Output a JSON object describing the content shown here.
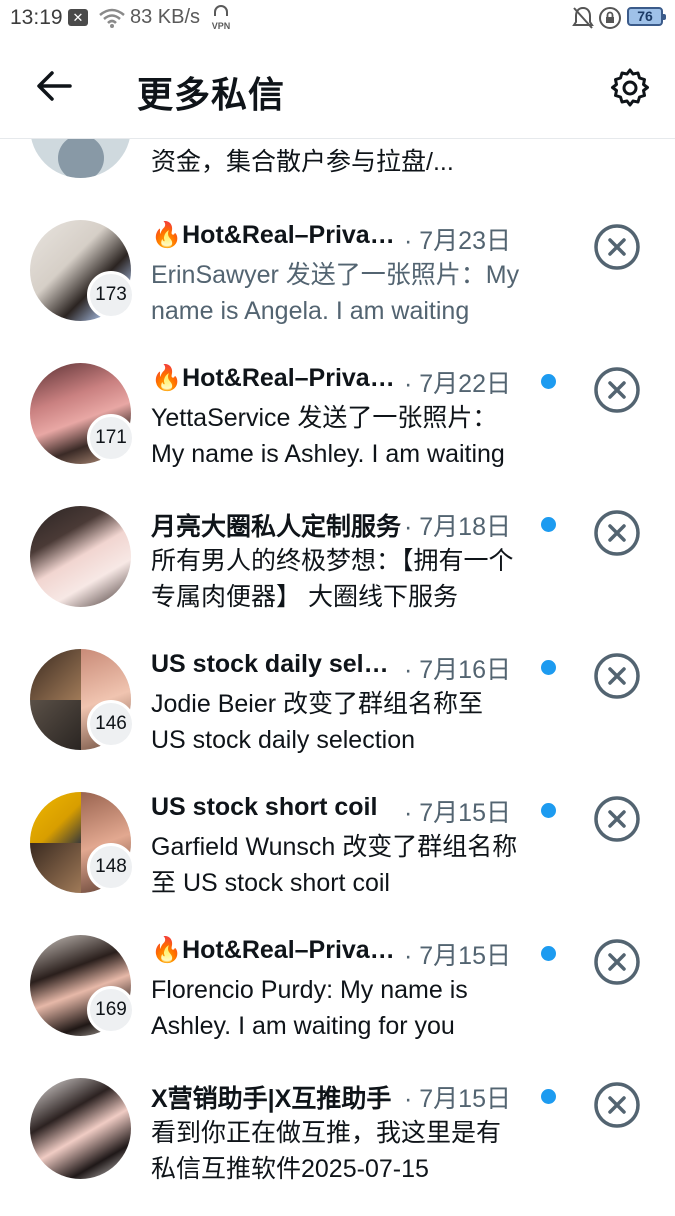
{
  "status_bar": {
    "time": "13:19",
    "notif_icon": "x-notification-icon",
    "network_speed": "83 KB/s",
    "vpn": "VPN",
    "battery": "76"
  },
  "header": {
    "title": "更多私信",
    "back_icon": "back-arrow-icon",
    "settings_icon": "gear-icon"
  },
  "partial_row": {
    "preview": "资金，集合散户参与拉盘/..."
  },
  "conversations": [
    {
      "name": "🔥Hot&Real–Private Chat",
      "date": "· 7月23日",
      "preview": "ErinSawyer 发送了一张照片：My name is Angela. I am waiting",
      "badge": "173",
      "unread": false
    },
    {
      "name": "🔥Hot&Real–Private Chat",
      "date": "· 7月22日",
      "preview": "YettaService 发送了一张照片：My name is Ashley. I am waiting",
      "badge": "171",
      "unread": true
    },
    {
      "name": "月亮大圈私人定制服务",
      "date": "· 7月18日",
      "preview": "所有男人的终极梦想：【拥有一个专属肉便器】 大圈线下服务",
      "badge": "",
      "unread": true
    },
    {
      "name": "US stock daily selection",
      "date": "· 7月16日",
      "preview": "Jodie Beier 改变了群组名称至 US stock daily selection",
      "badge": "146",
      "unread": true
    },
    {
      "name": "US stock short coil",
      "date": "· 7月15日",
      "preview": "Garfield Wunsch 改变了群组名称至 US stock short coil",
      "badge": "148",
      "unread": true
    },
    {
      "name": "🔥Hot&Real–Private Chat",
      "date": "· 7月15日",
      "preview": "Florencio Purdy: My name is Ashley. I am waiting for you",
      "badge": "169",
      "unread": true
    },
    {
      "name": "X营销助手|X互推助手",
      "date": "· 7月15日",
      "preview": "看到你正在做互推，我这里是有私信互推软件2025-07-15",
      "badge": "",
      "unread": true
    }
  ],
  "colors": {
    "accent": "#1d9bf0",
    "secondary_text": "#536471",
    "primary_text": "#0f1419"
  }
}
